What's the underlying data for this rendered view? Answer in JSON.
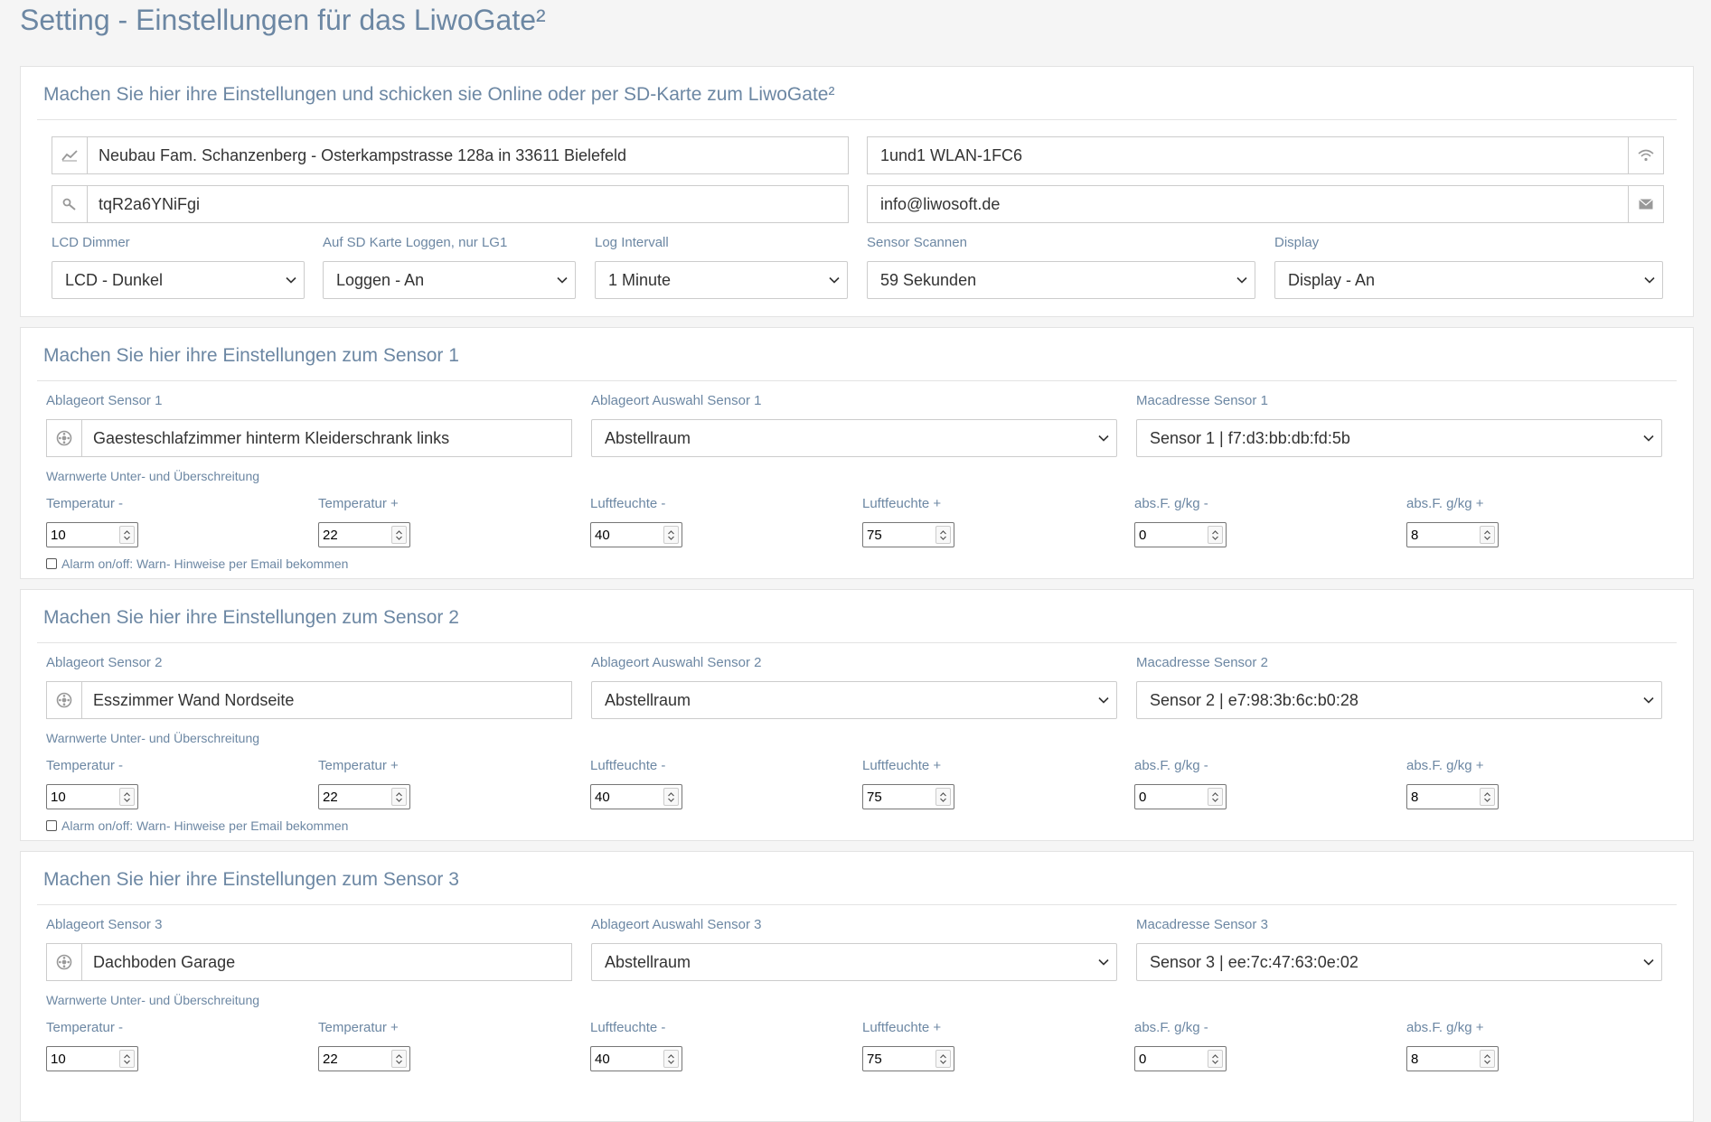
{
  "page_title": "Setting - Einstellungen für das LiwoGate²",
  "general": {
    "title": "Machen Sie hier ihre Einstellungen und schicken sie Online oder per SD-Karte zum LiwoGate²",
    "location_value": "Neubau Fam. Schanzenberg - Osterkampstrasse 128a in 33611 Bielefeld",
    "wlan_value": "1und1 WLAN-1FC6",
    "password_value": "tqR2a6YNiFgi",
    "email_value": "info@liwosoft.de",
    "lcd": {
      "label": "LCD Dimmer",
      "value": "LCD - Dunkel"
    },
    "sdlog": {
      "label": "Auf SD Karte Loggen, nur LG1",
      "value": "Loggen - An"
    },
    "interval": {
      "label": "Log Intervall",
      "value": "1 Minute"
    },
    "scan": {
      "label": "Sensor Scannen",
      "value": "59 Sekunden"
    },
    "display": {
      "label": "Display",
      "value": "Display - An"
    }
  },
  "icons": {
    "location": "chart-line-icon",
    "wlan": "wifi-icon",
    "password": "key-icon",
    "email": "envelope-icon",
    "sensor_location": "gear-icon",
    "dropdown": "chevron-down-icon",
    "spinner": "spinner-arrows-icon"
  },
  "sensors": [
    {
      "title": "Machen Sie hier ihre Einstellungen zum Sensor 1",
      "loc_label": "Ablageort Sensor 1",
      "loc_value": "Gaesteschlafzimmer hinterm Kleiderschrank links",
      "sel_label": "Ablageort Auswahl Sensor 1",
      "sel_value": "Abstellraum",
      "mac_label": "Macadresse Sensor 1",
      "mac_value": "Sensor 1 | f7:d3:bb:db:fd:5b",
      "warn_label": "Warnwerte Unter- und Überschreitung",
      "fields": [
        {
          "label": "Temperatur -",
          "value": "10"
        },
        {
          "label": "Temperatur +",
          "value": "22"
        },
        {
          "label": "Luftfeuchte -",
          "value": "40"
        },
        {
          "label": "Luftfeuchte +",
          "value": "75"
        },
        {
          "label": "abs.F. g/kg -",
          "value": "0"
        },
        {
          "label": "abs.F. g/kg +",
          "value": "8"
        }
      ],
      "alarm_label": "Alarm on/off: Warn- Hinweise per Email bekommen"
    },
    {
      "title": "Machen Sie hier ihre Einstellungen zum Sensor 2",
      "loc_label": "Ablageort Sensor 2",
      "loc_value": "Esszimmer Wand Nordseite",
      "sel_label": "Ablageort Auswahl Sensor 2",
      "sel_value": "Abstellraum",
      "mac_label": "Macadresse Sensor 2",
      "mac_value": "Sensor 2 | e7:98:3b:6c:b0:28",
      "warn_label": "Warnwerte Unter- und Überschreitung",
      "fields": [
        {
          "label": "Temperatur -",
          "value": "10"
        },
        {
          "label": "Temperatur +",
          "value": "22"
        },
        {
          "label": "Luftfeuchte -",
          "value": "40"
        },
        {
          "label": "Luftfeuchte +",
          "value": "75"
        },
        {
          "label": "abs.F. g/kg -",
          "value": "0"
        },
        {
          "label": "abs.F. g/kg +",
          "value": "8"
        }
      ],
      "alarm_label": "Alarm on/off: Warn- Hinweise per Email bekommen"
    },
    {
      "title": "Machen Sie hier ihre Einstellungen zum Sensor 3",
      "loc_label": "Ablageort Sensor 3",
      "loc_value": "Dachboden Garage",
      "sel_label": "Ablageort Auswahl Sensor 3",
      "sel_value": "Abstellraum",
      "mac_label": "Macadresse Sensor 3",
      "mac_value": "Sensor 3 | ee:7c:47:63:0e:02",
      "warn_label": "Warnwerte Unter- und Überschreitung",
      "fields": [
        {
          "label": "Temperatur -",
          "value": "10"
        },
        {
          "label": "Temperatur +",
          "value": "22"
        },
        {
          "label": "Luftfeuchte -",
          "value": "40"
        },
        {
          "label": "Luftfeuchte +",
          "value": "75"
        },
        {
          "label": "abs.F. g/kg -",
          "value": "0"
        },
        {
          "label": "abs.F. g/kg +",
          "value": "8"
        }
      ]
    }
  ]
}
